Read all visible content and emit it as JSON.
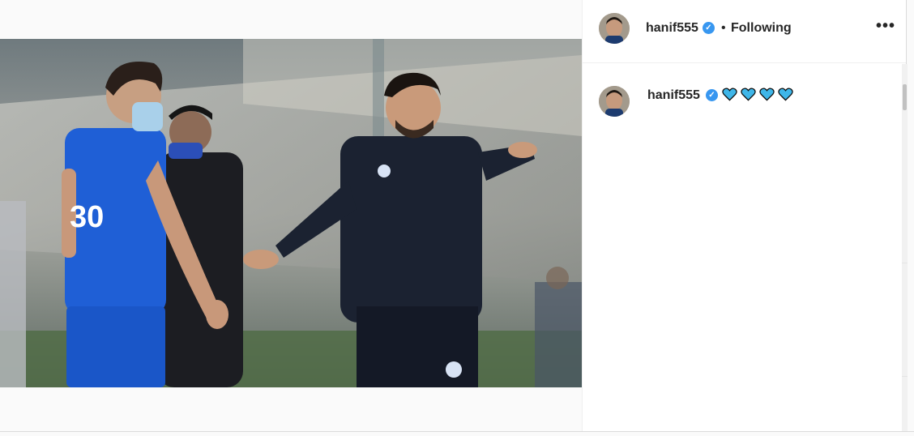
{
  "post": {
    "author": {
      "username": "hanif555",
      "verified": true,
      "avatar_icon": "profile-photo"
    },
    "header": {
      "separator": "•",
      "follow_status": "Following",
      "more_label": "•••"
    },
    "caption": {
      "username": "hanif555",
      "emoji": [
        "💙",
        "💙",
        "💙",
        "💙"
      ]
    },
    "photo": {
      "jersey_number": "30"
    }
  },
  "colors": {
    "accent": "#3897f0",
    "heart": "#3fb6e8",
    "text": "#262626",
    "jersey": "#1f5fd6"
  }
}
